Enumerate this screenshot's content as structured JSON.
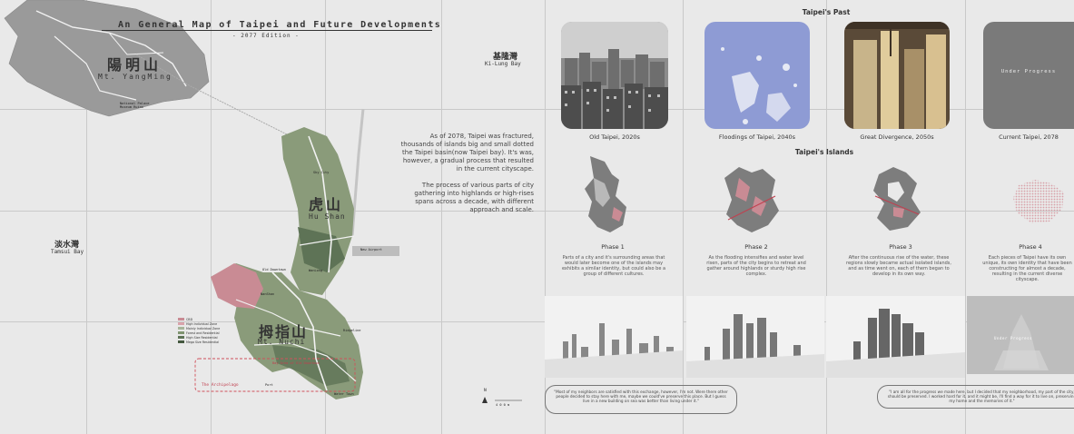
{
  "title": "An General Map of Taipei and Future Developments",
  "edition": "- 2077 Edition -",
  "places": {
    "yangming_cn": "陽明山",
    "yangming_en": "Mt. YangMing",
    "keelung_cn": "基隆灣",
    "keelung_en": "Ki-Lung Bay",
    "tamsui_cn": "淡水灣",
    "tamsui_en": "Tamsui Bay",
    "hushan_cn": "虎山",
    "hushan_en": "Hu Shan",
    "mtnuchi_cn": "拇指山",
    "mtnuchi_en": "Mt. Nuchi"
  },
  "map_labels": {
    "national_palace": "National Palace Museum Ruins",
    "new_airport": "New Airport",
    "old_downtown": "Old Downtown",
    "wanlong": "WanLong",
    "sky_city": "Sky City",
    "bay_area": "Bay Area of Old Downtown",
    "archipelago": "The Archipelago",
    "port": "Port",
    "water_town": "Water Town",
    "nanshan": "NanShan",
    "ridgeline": "Ridgeline",
    "scale": "4 0 0 m",
    "north": "N"
  },
  "legend": [
    {
      "label": "CBD",
      "color": "#c98b94"
    },
    {
      "label": "High Individual Zone",
      "color": "#d9a3ab"
    },
    {
      "label": "Mainly Individual Zone",
      "color": "#a7b59a"
    },
    {
      "label": "Forest and Residential",
      "color": "#7f9470"
    },
    {
      "label": "High Size Residential",
      "color": "#5e7356"
    },
    {
      "label": "Mega Size Residential",
      "color": "#44583f"
    }
  ],
  "intro": {
    "p1": "As of 2078, Taipei was fractured, thousands of islands big and small dotted the Taipei basin(now Taipei bay). It's was, however, a gradual process that resulted in the current cityscape.",
    "p2": "The process of various parts of city gathering into highlands or high-rises spans across a decade, with different approach and scale."
  },
  "past": {
    "title": "Taipei's Past",
    "items": [
      {
        "caption": "Old Taipei, 2020s"
      },
      {
        "caption": "Floodings of Taipei, 2040s"
      },
      {
        "caption": "Great Divergence, 2050s"
      },
      {
        "caption": "Current Taipei, 2078",
        "overlay": "Under Progress"
      }
    ]
  },
  "islands": {
    "title": "Taipei's Islands",
    "phases": [
      {
        "title": "Phase 1",
        "text": "Parts of a city and it's surrounding areas that would later become one of the islands may exhibits a similar identity, but could also be a group of different cultures."
      },
      {
        "title": "Phase 2",
        "text": "As the flooding intensifies and water level risen, parts of the city begins to retreat and gather around highlands or sturdy high rise complex."
      },
      {
        "title": "Phase 3",
        "text": "After the continuous rise of the water, these regions slowly became actual isolated islands, and as time went on, each of them began to develop in its own way."
      },
      {
        "title": "Phase 4",
        "text": "Each pieces of Taipei have its own unique, its own identity that have been constructing for almost a decade, resulting in the current diverse cityscape."
      }
    ],
    "under_progress": "Under Progress"
  },
  "quotes": {
    "q1": "\"Most of my neighbors are satisfied with this exchange, however, I'm not. Were there other people decided to stay here with me, maybe we could've preserve this place. But I guess live in a new building on sea was better than living under it.\"",
    "q2": "\"I am all for the progress we made here, but I decided that my neighborhood, my part of the city, should be preserved. I worked hard for it, and it might be, I'll find a way for it to live on, preserving my home and the memories of it.\""
  },
  "colors": {
    "background": "#e9e9e9",
    "grid": "#c9c9c9",
    "land_green": "#8a9b7a",
    "land_dark": "#5e7356",
    "cbd_pink": "#c98b94",
    "dashed_red": "#d0505a",
    "mountain_gray": "#9a9a9a",
    "flood_blue": "#8e9bd4",
    "tile_dark": "#7a7a7a"
  }
}
